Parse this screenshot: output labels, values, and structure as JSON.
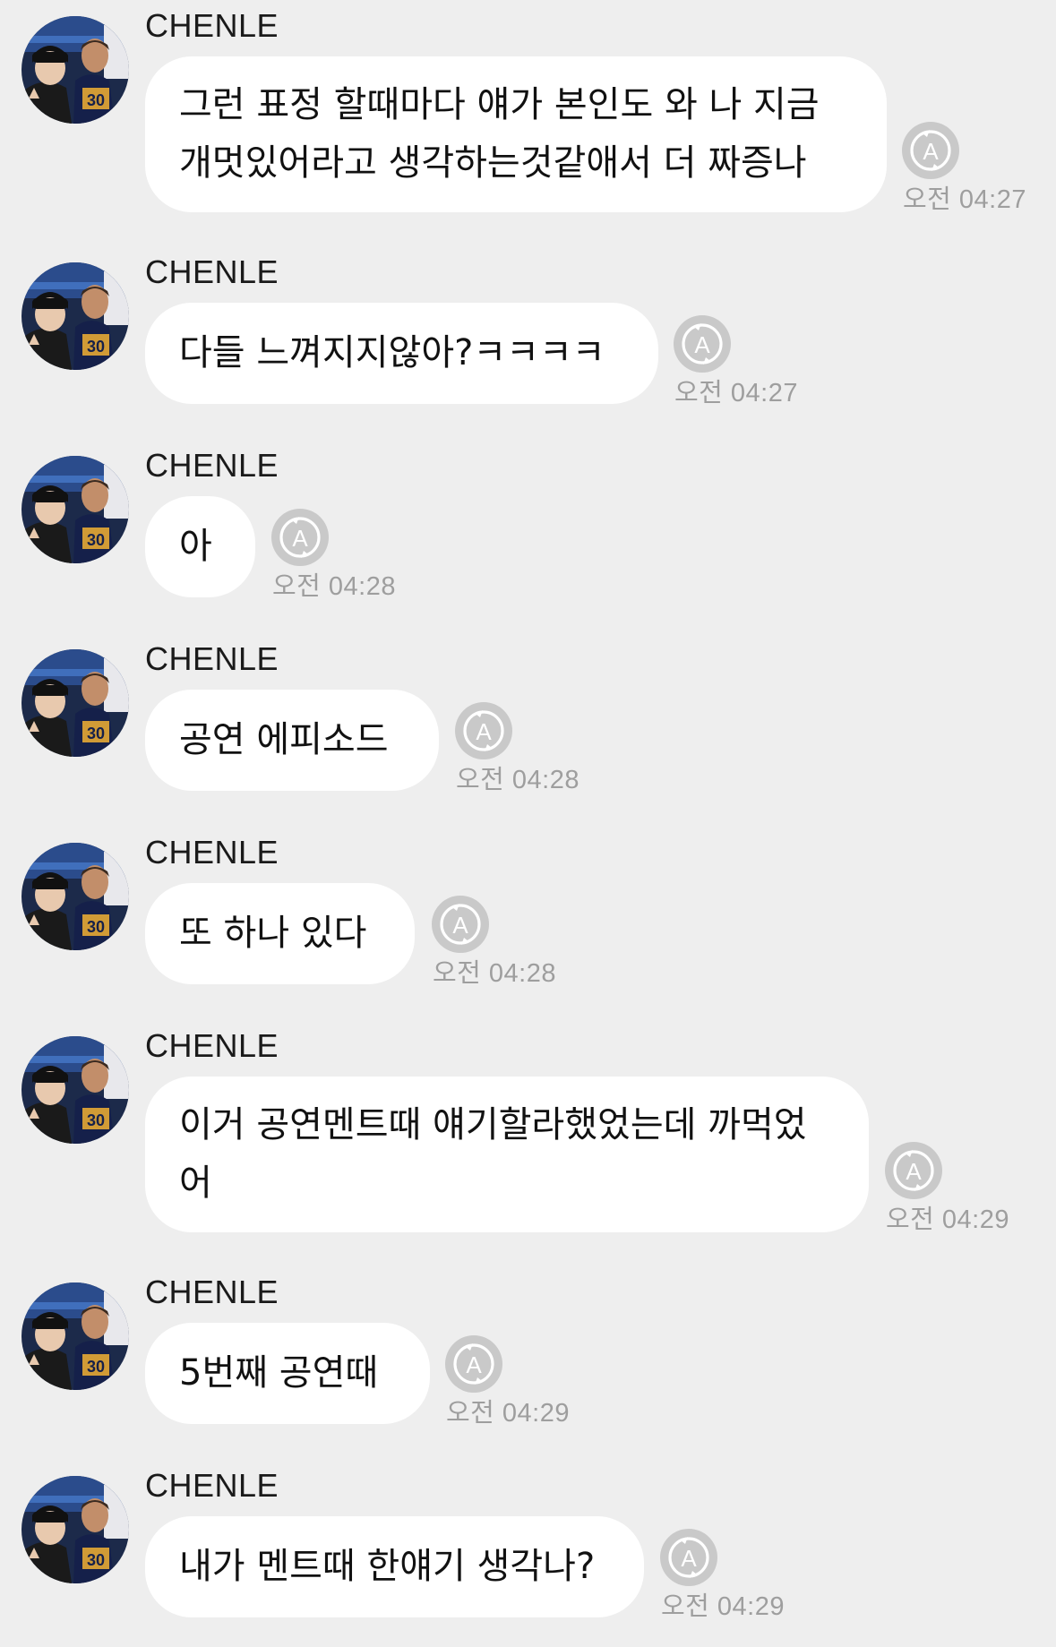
{
  "messages": [
    {
      "sender": "CHENLE",
      "lines": [
        "그런 표정 할때마다 얘가 본인도 와 나 지금",
        "개멋있어라고 생각하는것같애서 더 짜증나"
      ],
      "time": "오전 04:27"
    },
    {
      "sender": "CHENLE",
      "lines": [
        "다들 느껴지지않아?ㅋㅋㅋㅋ"
      ],
      "time": "오전 04:27"
    },
    {
      "sender": "CHENLE",
      "lines": [
        "아"
      ],
      "time": "오전 04:28"
    },
    {
      "sender": "CHENLE",
      "lines": [
        "공연 에피소드"
      ],
      "time": "오전 04:28"
    },
    {
      "sender": "CHENLE",
      "lines": [
        "또 하나 있다"
      ],
      "time": "오전 04:28"
    },
    {
      "sender": "CHENLE",
      "lines": [
        "이거 공연멘트때 얘기할라했었는데 까먹었",
        "어"
      ],
      "time": "오전 04:29"
    },
    {
      "sender": "CHENLE",
      "lines": [
        "5번째 공연때"
      ],
      "time": "오전 04:29"
    },
    {
      "sender": "CHENLE",
      "lines": [
        "내가 멘트때 한얘기 생각나?"
      ],
      "time": "오전 04:29"
    }
  ],
  "icons": {
    "avatar": "profile-photo",
    "translate": "auto-translate-icon"
  },
  "colors": {
    "background": "#eeeeee",
    "bubble": "#ffffff",
    "time": "#9e9e9e",
    "text": "#111111"
  }
}
